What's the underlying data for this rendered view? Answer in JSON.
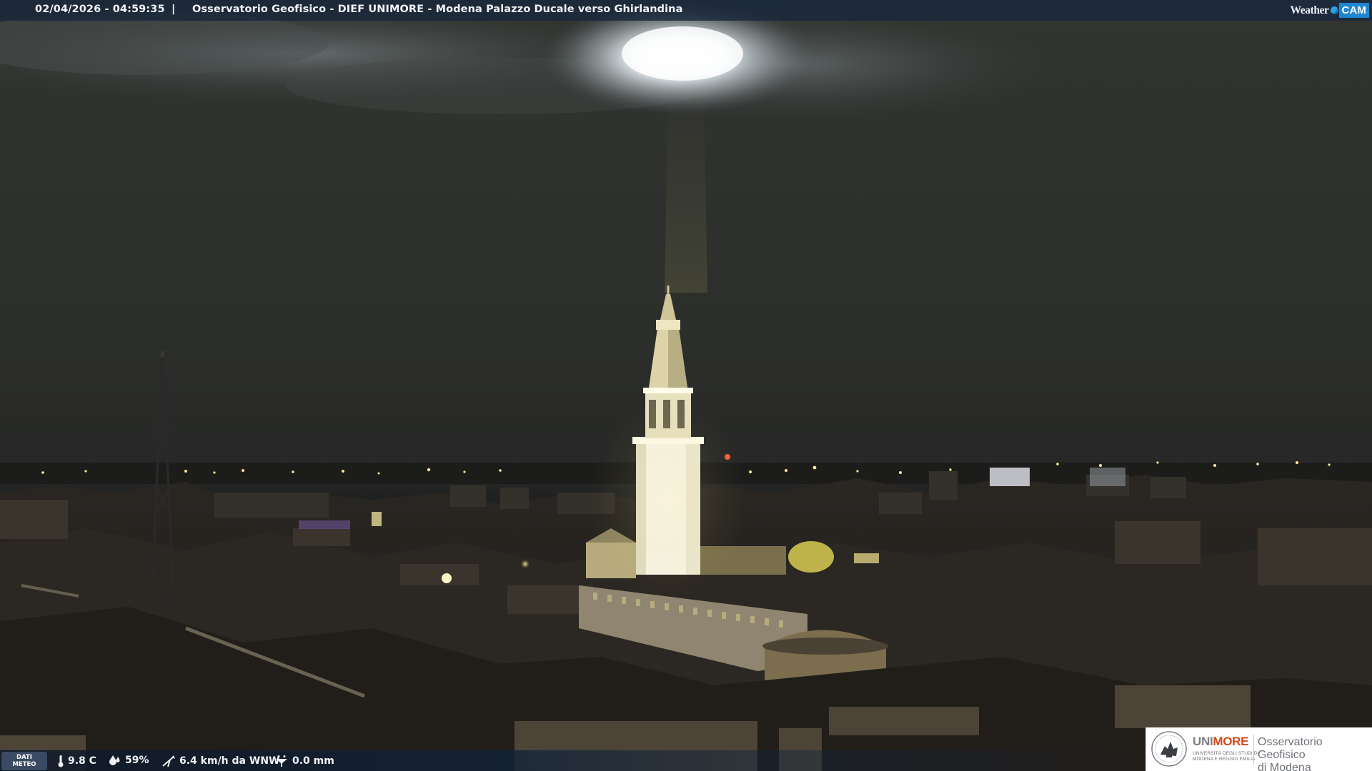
{
  "overlay": {
    "timestamp": "02/04/2026 - 04:59:35",
    "separator": "|",
    "title": "Osservatorio Geofisico - DIEF UNIMORE - Modena Palazzo Ducale verso Ghirlandina",
    "brand_weather": "Weather",
    "brand_cam": "CAM"
  },
  "weather_strip": {
    "badge_line1": "DATI",
    "badge_line2": "METEO",
    "temperature": "9.8 C",
    "humidity": "59%",
    "wind": "6.4 km/h da WNW",
    "rain": "0.0 mm"
  },
  "logo": {
    "uni_part1": "UNI",
    "uni_part2": "MORE",
    "uni_sub1": "UNIVERSITÀ DEGLI STUDI DI",
    "uni_sub2": "MODENA E REGGIO EMILIA",
    "obs_line1": "Osservatorio Geofisico",
    "obs_line2": "di Modena"
  },
  "colors": {
    "sky": "#2e302c",
    "moon_glow": "#f2f6fa",
    "tower": "#f3f0da",
    "city_light": "#ffd96a",
    "accent_orange": "#d2491d",
    "brand_blue": "#1d86d1"
  }
}
